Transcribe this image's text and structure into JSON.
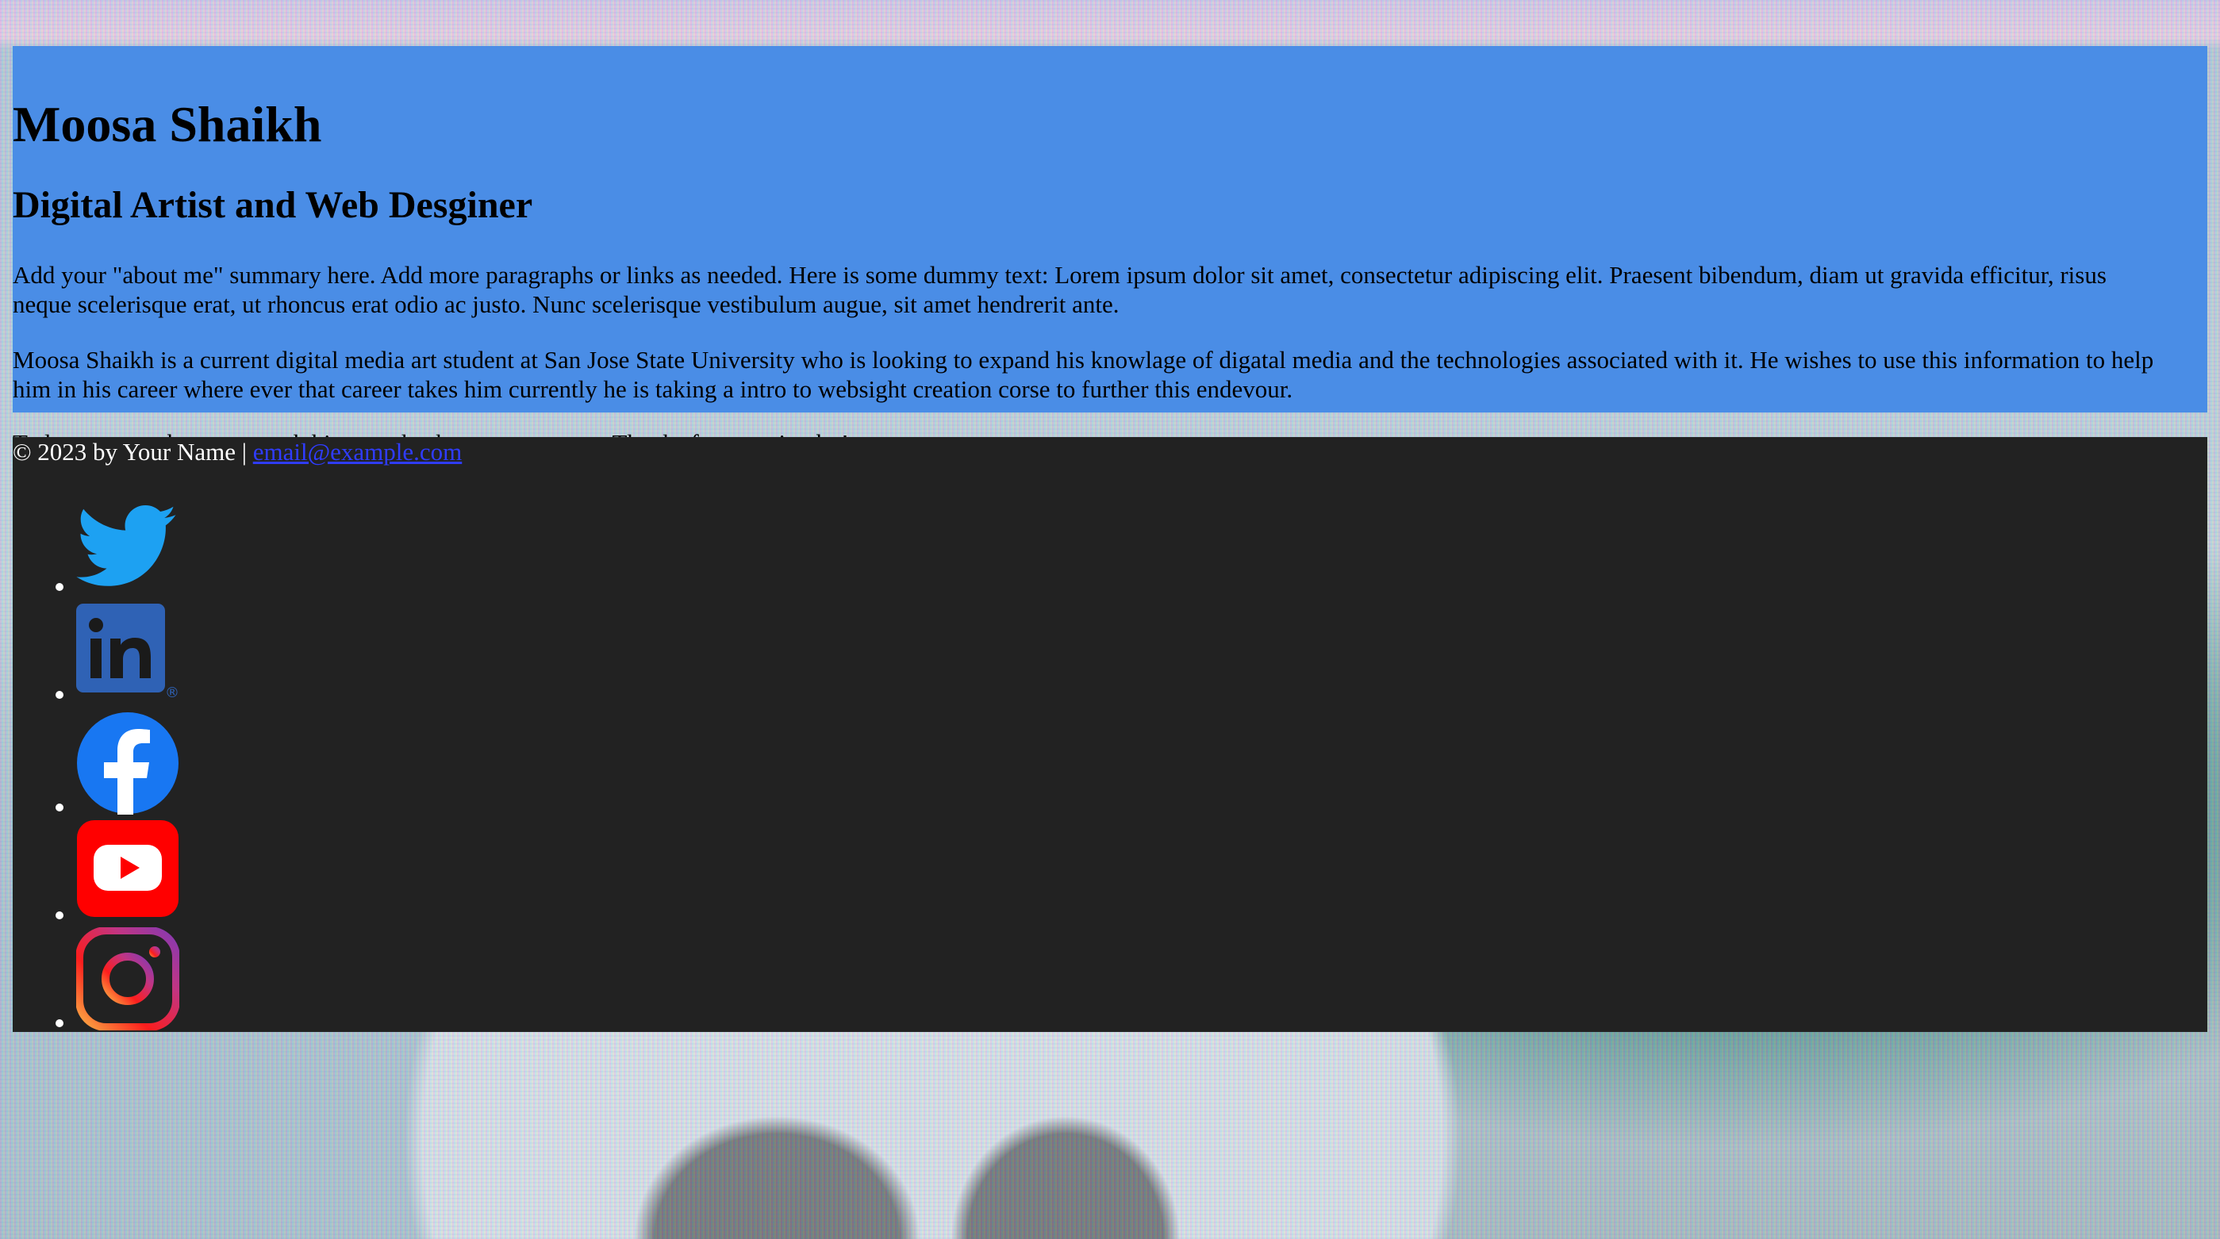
{
  "profile": {
    "name": "Moosa Shaikh",
    "title": "Digital Artist and Web Desginer",
    "summary": "Add your \"about me\" summary here. Add more paragraphs or links as needed. Here is some dummy text: Lorem ipsum dolor sit amet, consectetur adipiscing elit. Praesent bibendum, diam ut gravida efficitur, risus neque scelerisque erat, ut rhoncus erat odio ac justo. Nunc scelerisque vestibulum augue, sit amet hendrerit ante.",
    "bio": "Moosa Shaikh is a current digital media art student at San Jose State University who is looking to expand his knowlage of digatal media and the technologies associated with it. He wishes to use this information to help him in his career where ever that career takes him currently he is taking a intro to websight creation corse to further this endevour.",
    "resume_prefix": "To learn more about my work history, check out my ",
    "resume_link": "resume",
    "resume_suffix": ". Thanks for stopping by!"
  },
  "footer": {
    "copyright": "© 2023 by Your Name | ",
    "email": "email@example.com"
  },
  "social": [
    {
      "name": "twitter",
      "icon": "twitter-icon"
    },
    {
      "name": "linkedin",
      "icon": "linkedin-icon"
    },
    {
      "name": "facebook",
      "icon": "facebook-icon"
    },
    {
      "name": "youtube",
      "icon": "youtube-icon"
    },
    {
      "name": "instagram",
      "icon": "instagram-icon"
    }
  ],
  "colors": {
    "header_bg": "#4a8de6",
    "footer_bg": "#222222",
    "link_visited": "#5d3fa4",
    "link_unvisited": "#2f3cff"
  }
}
